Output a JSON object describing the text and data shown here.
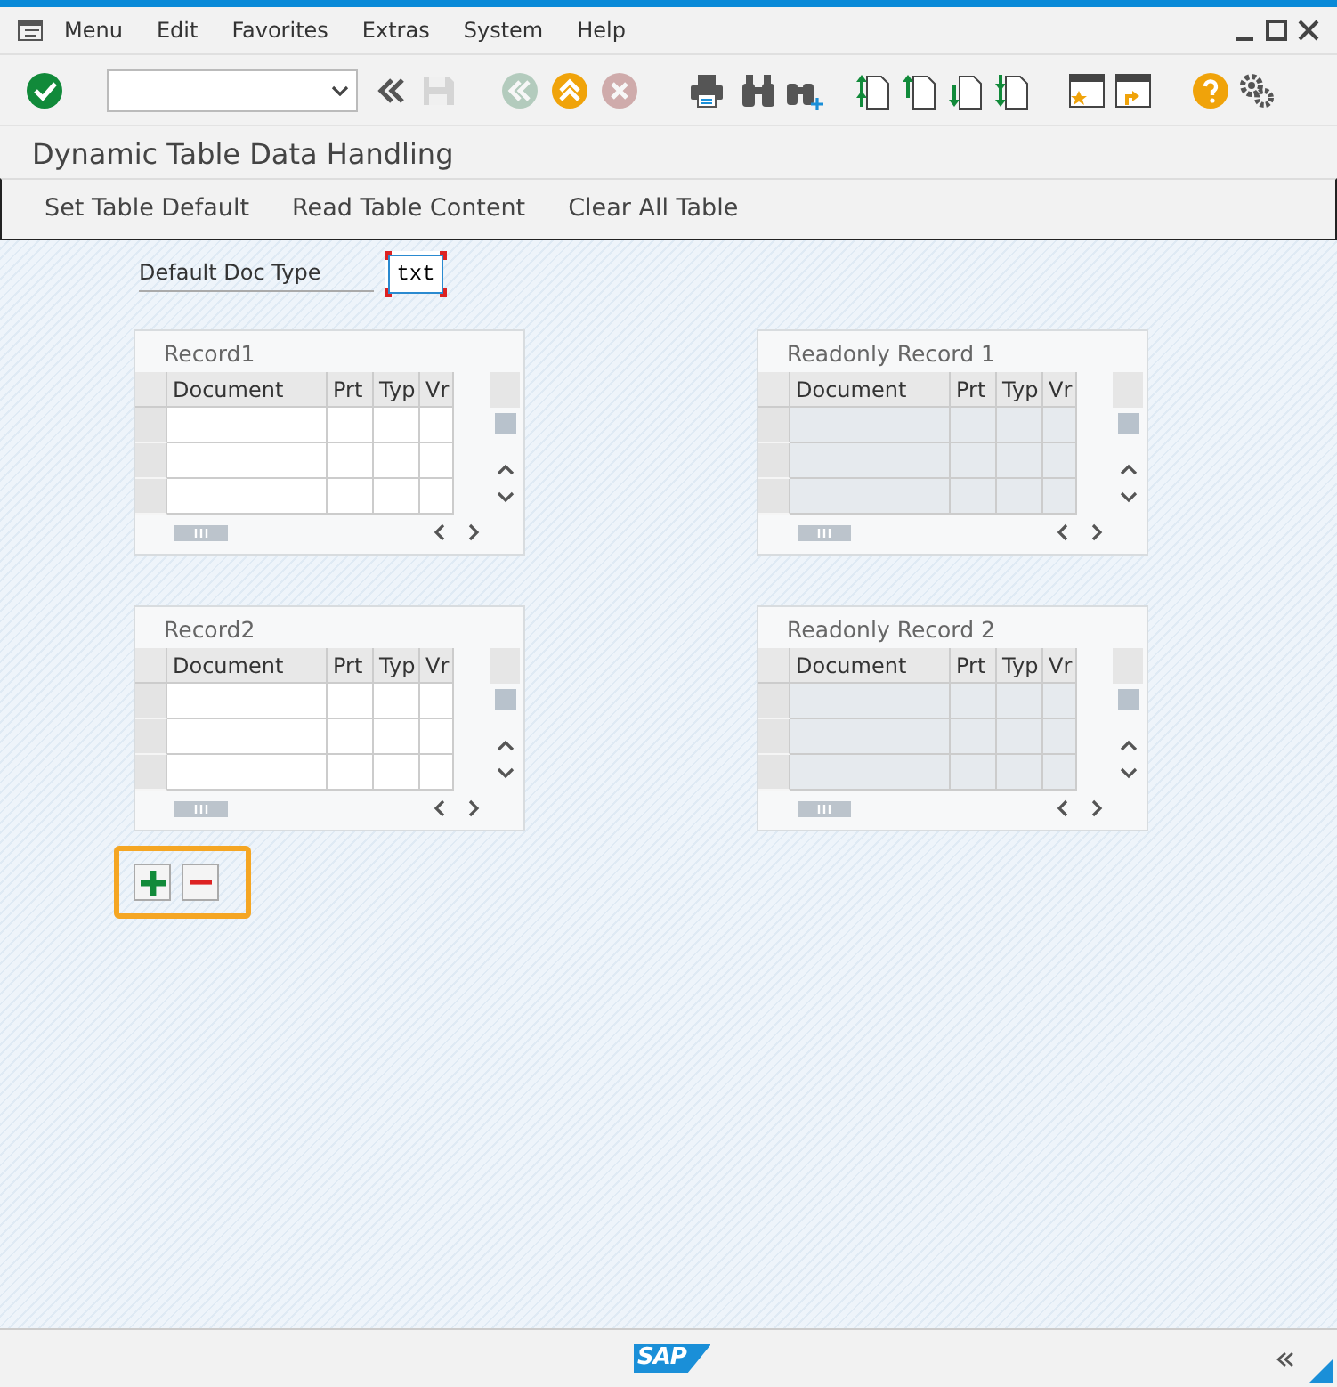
{
  "menu_bar": {
    "items": [
      "Menu",
      "Edit",
      "Favorites",
      "Extras",
      "System",
      "Help"
    ]
  },
  "toolbar": [
    {
      "kind": "enter",
      "disabled": false
    },
    {
      "kind": "command-field"
    },
    {
      "kind": "collapse",
      "disabled": false
    },
    {
      "kind": "save",
      "disabled": true
    },
    {
      "kind": "back",
      "disabled": true
    },
    {
      "kind": "exit",
      "disabled": false
    },
    {
      "kind": "cancel",
      "disabled": true
    },
    {
      "kind": "print",
      "disabled": false
    },
    {
      "kind": "find",
      "disabled": false
    },
    {
      "kind": "find-next",
      "disabled": false
    },
    {
      "kind": "first-page",
      "disabled": false
    },
    {
      "kind": "previous-page",
      "disabled": false
    },
    {
      "kind": "next-page",
      "disabled": false
    },
    {
      "kind": "last-page",
      "disabled": false
    },
    {
      "kind": "new-session",
      "disabled": false
    },
    {
      "kind": "shortcut",
      "disabled": false
    },
    {
      "kind": "help",
      "disabled": false
    },
    {
      "kind": "settings",
      "disabled": false
    }
  ],
  "screen_title": "Dynamic Table Data Handling",
  "app_toolbar": [
    "Set Table Default",
    "Read Table Content",
    "Clear All Table"
  ],
  "field": {
    "label": "Default Doc Type",
    "value": "txt"
  },
  "tables": [
    {
      "title": "Record1",
      "readonly": false,
      "columns": [
        "Document",
        "Prt",
        "Typ",
        "Vr"
      ]
    },
    {
      "title": "Readonly Record 1",
      "readonly": true,
      "columns": [
        "Document",
        "Prt",
        "Typ",
        "Vr"
      ]
    },
    {
      "title": "Record2",
      "readonly": false,
      "columns": [
        "Document",
        "Prt",
        "Typ",
        "Vr"
      ]
    },
    {
      "title": "Readonly Record 2",
      "readonly": true,
      "columns": [
        "Document",
        "Prt",
        "Typ",
        "Vr"
      ]
    }
  ],
  "row_buttons": {
    "highlighted": true,
    "items": [
      {
        "kind": "add"
      },
      {
        "kind": "remove"
      }
    ]
  },
  "footer": {
    "logo": "SAP"
  }
}
